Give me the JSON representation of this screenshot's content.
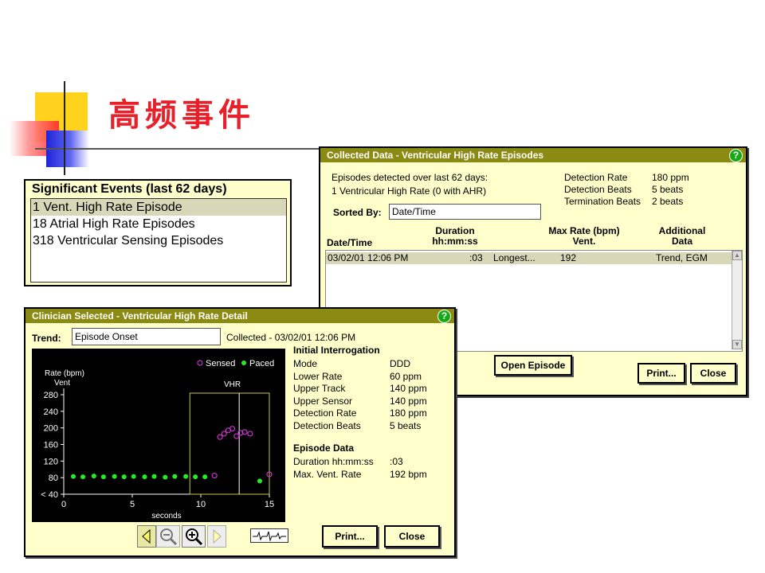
{
  "slide": {
    "title": "高频事件"
  },
  "significant_events": {
    "title": "Significant Events (last 62 days)",
    "items": [
      "1 Vent. High Rate Episode",
      "18 Atrial High Rate Episodes",
      "318 Ventricular Sensing Episodes"
    ]
  },
  "collected": {
    "title": "Collected Data - Ventricular High Rate Episodes",
    "help": "?",
    "summary1": "Episodes detected over last 62 days:",
    "summary2": "1 Ventricular High Rate (0 with AHR)",
    "detection_rate_label": "Detection Rate",
    "detection_rate_value": "180 ppm",
    "detection_beats_label": "Detection Beats",
    "detection_beats_value": "5 beats",
    "termination_beats_label": "Termination Beats",
    "termination_beats_value": "2 beats",
    "sorted_by_label": "Sorted By:",
    "sorted_by_value": "Date/Time",
    "col_date": "Date/Time",
    "col_duration": "Duration\nhh:mm:ss",
    "col_maxrate": "Max Rate (bpm)\nVent.",
    "col_additional": "Additional\nData",
    "row": {
      "date": "03/02/01 12:06 PM",
      "duration": ":03",
      "note": "Longest...",
      "rate": "192",
      "additional": "Trend, EGM"
    },
    "open_episode": "Open Episode",
    "print": "Print...",
    "close": "Close"
  },
  "detail": {
    "title": "Clinician Selected - Ventricular High Rate Detail",
    "help": "?",
    "trend_label": "Trend:",
    "trend_value": "Episode Onset",
    "collected_text": "Collected - 03/02/01 12:06 PM",
    "initial_interrogation": "Initial Interrogation",
    "params": [
      {
        "label": "Mode",
        "value": "DDD"
      },
      {
        "label": "Lower Rate",
        "value": "60 ppm"
      },
      {
        "label": "Upper Track",
        "value": "140 ppm"
      },
      {
        "label": "Upper Sensor",
        "value": "140 ppm"
      },
      {
        "label": "Detection Rate",
        "value": "180 ppm"
      },
      {
        "label": "Detection Beats",
        "value": "5 beats"
      }
    ],
    "episode_data": "Episode Data",
    "episode_params": [
      {
        "label": "Duration hh:mm:ss",
        "value": ":03"
      },
      {
        "label": "Max. Vent. Rate",
        "value": "192 bpm"
      }
    ],
    "print": "Print...",
    "close": "Close"
  },
  "chart_data": {
    "type": "scatter",
    "ylabel_line1": "Rate (bpm)",
    "ylabel_line2": "Vent",
    "xlabel": "seconds",
    "xlim": [
      0,
      15
    ],
    "ylim": [
      40,
      280
    ],
    "yticks": [
      "280",
      "240",
      "200",
      "160",
      "120",
      "80",
      "< 40"
    ],
    "ytick_values": [
      280,
      240,
      200,
      160,
      120,
      80,
      40
    ],
    "xticks": [
      0,
      5,
      10,
      15
    ],
    "legend": {
      "sensed": "Sensed",
      "paced": "Paced",
      "position": "top-right"
    },
    "vhr_label": "VHR",
    "vhr_window": [
      9.2,
      15
    ],
    "vhr_marker": 12.8,
    "colors": {
      "sensed": "#cc33cc",
      "paced": "#22ee22",
      "axis": "#ffffff",
      "window": "#c8c840"
    },
    "series": [
      {
        "name": "Paced",
        "marker": "filled",
        "points": [
          [
            0.7,
            83
          ],
          [
            1.4,
            82
          ],
          [
            2.2,
            84
          ],
          [
            2.9,
            82
          ],
          [
            3.7,
            83
          ],
          [
            4.4,
            82
          ],
          [
            5.1,
            83
          ],
          [
            5.9,
            82
          ],
          [
            6.6,
            83
          ],
          [
            7.4,
            81
          ],
          [
            8.1,
            83
          ],
          [
            8.9,
            83
          ],
          [
            9.6,
            82
          ],
          [
            10.3,
            82
          ],
          [
            14.3,
            72
          ]
        ]
      },
      {
        "name": "Sensed",
        "marker": "open",
        "points": [
          [
            11.0,
            85
          ],
          [
            11.4,
            178
          ],
          [
            11.7,
            186
          ],
          [
            12.0,
            194
          ],
          [
            12.3,
            198
          ],
          [
            12.6,
            180
          ],
          [
            12.9,
            188
          ],
          [
            13.2,
            190
          ],
          [
            13.6,
            186
          ],
          [
            15.0,
            88
          ]
        ]
      }
    ]
  }
}
